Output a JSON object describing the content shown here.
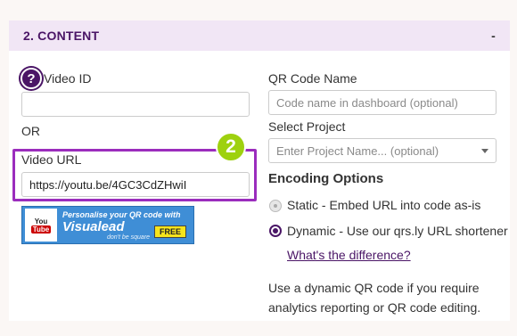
{
  "header": {
    "title": "2. CONTENT",
    "collapse": "-"
  },
  "left": {
    "video_id_label": "Video ID",
    "help_icon": "?",
    "video_id_value": "",
    "or_label": "OR",
    "video_url_label": "Video URL",
    "video_url_value": "https://youtu.be/4GC3CdZHwiI",
    "step_badge": "2",
    "banner": {
      "you": "You",
      "tube": "Tube",
      "line1": "Personalise your QR code with",
      "brand": "Visualead",
      "tagline": "don't be square",
      "free": "FREE"
    }
  },
  "right": {
    "qr_name_label": "QR Code Name",
    "qr_name_placeholder": "Code name in dashboard (optional)",
    "project_label": "Select Project",
    "project_placeholder": "Enter Project Name... (optional)",
    "encoding_heading": "Encoding Options",
    "option_static": "Static - Embed URL into code as-is",
    "option_dynamic": "Dynamic - Use our qrs.ly URL shortener",
    "selected_option": "dynamic",
    "difference_link": "What's the difference?",
    "info_line1": "Use a dynamic QR code if you require",
    "info_line2": "analytics reporting or QR code editing."
  },
  "colors": {
    "accent": "#4a1566",
    "highlight": "#9b2dbd",
    "badge": "#9ed10f",
    "header_bg": "#f1e6f5"
  }
}
